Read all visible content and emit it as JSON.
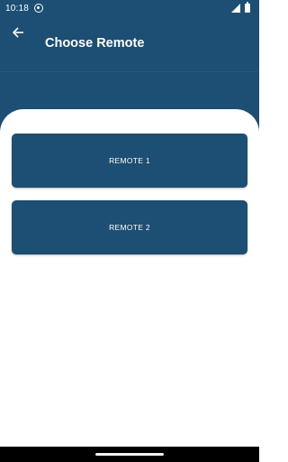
{
  "status_bar": {
    "time": "10:18"
  },
  "toolbar": {
    "title": "Choose Remote"
  },
  "remotes": [
    {
      "label": "REMOTE 1"
    },
    {
      "label": "REMOTE 2"
    }
  ],
  "colors": {
    "primary": "#1d4e73",
    "background": "#ffffff",
    "text_on_primary": "#ffffff"
  },
  "icons": {
    "back": "arrow-left-icon",
    "status_notification": "circle-icon",
    "signal": "signal-icon",
    "battery": "battery-icon"
  }
}
